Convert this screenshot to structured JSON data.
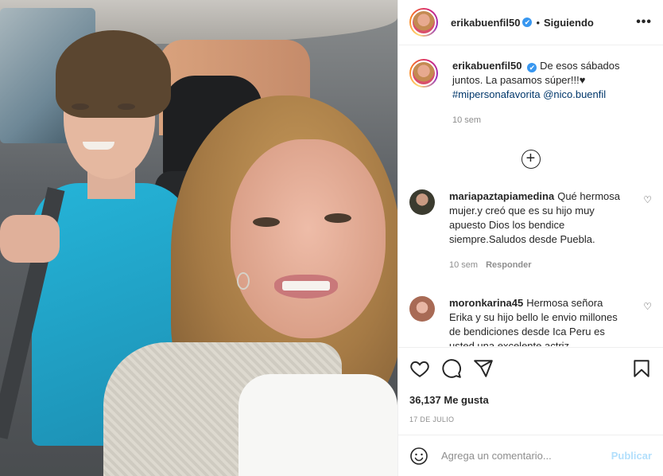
{
  "post": {
    "author": "erikabuenfil50",
    "follow_status": "Siguiendo",
    "more_label": "•••",
    "caption_text": "De esos sábados juntos. La pasamos súper!!!♥",
    "caption_hashtag": "#mipersonafavorita",
    "caption_mention": "@nico.buenfil",
    "caption_time": "10 sem",
    "load_more_label": "+",
    "verified_mark": "✔"
  },
  "comments": [
    {
      "user": "mariapaztapiamedina",
      "text": "Qué hermosa mujer.y creó que es su hijo muy apuesto Dios los bendice siempre.Saludos desde Puebla.",
      "time": "10 sem",
      "reply_label": "Responder"
    },
    {
      "user": "moronkarina45",
      "text": "Hermosa señora Erika y su hijo bello le envio millones de bendiciones desde Ica Peru es usted una excelente actriz"
    }
  ],
  "actions": {
    "likes": "36,137 Me gusta",
    "date": "17 DE JULIO"
  },
  "add_comment": {
    "placeholder": "Agrega un comentario...",
    "publish_label": "Publicar"
  },
  "colors": {
    "link": "#00376b",
    "verified": "#3897f0",
    "publish_disabled": "#b2dffc",
    "muted": "#8e8e8e"
  },
  "icons": [
    "more-options-icon",
    "verified-badge-icon",
    "add-circle-icon",
    "heart-icon",
    "comment-icon",
    "share-icon",
    "save-icon",
    "emoji-icon"
  ]
}
